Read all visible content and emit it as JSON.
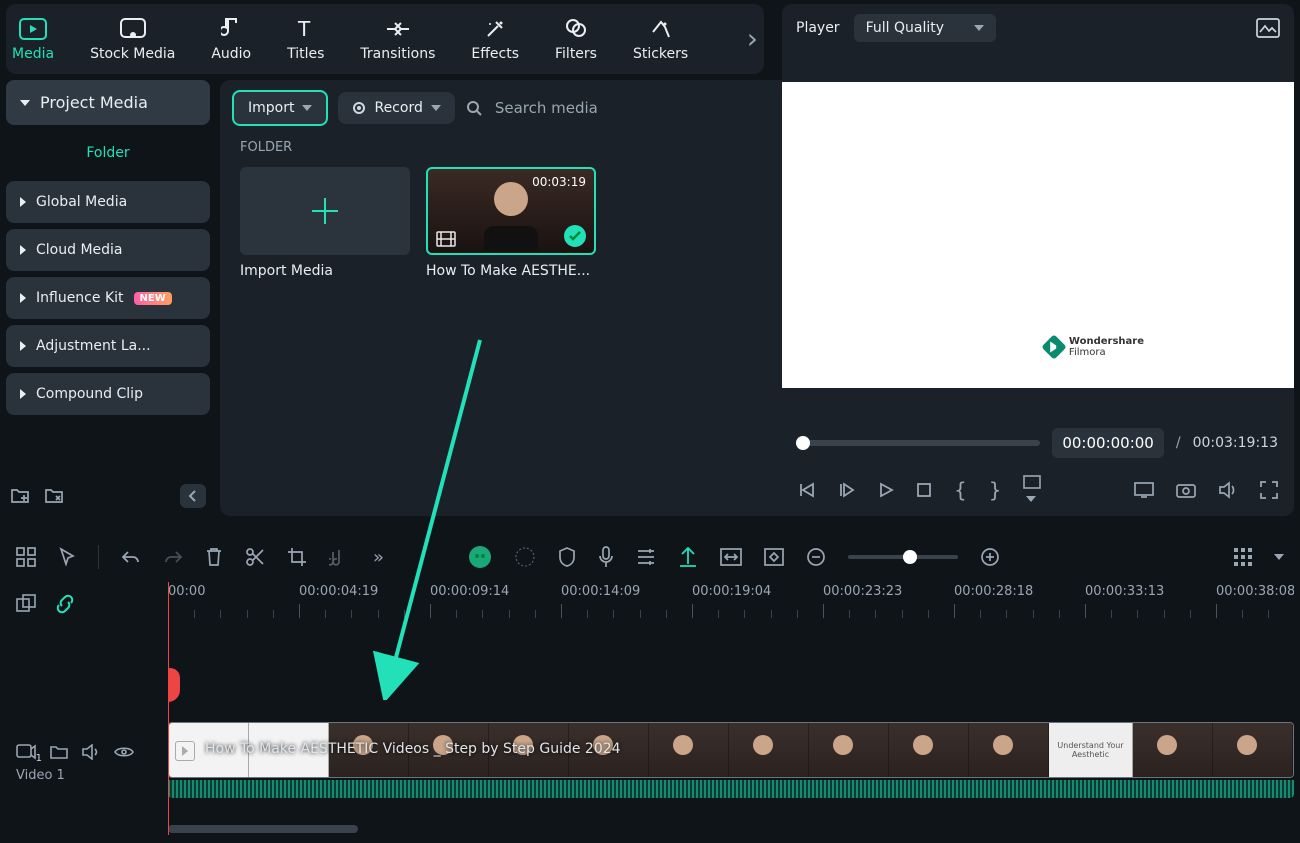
{
  "tabs": {
    "media": "Media",
    "stock": "Stock Media",
    "audio": "Audio",
    "titles": "Titles",
    "transitions": "Transitions",
    "effects": "Effects",
    "filters": "Filters",
    "stickers": "Stickers"
  },
  "sidebar": {
    "project": "Project Media",
    "folder": "Folder",
    "global": "Global Media",
    "cloud": "Cloud Media",
    "influence": "Influence Kit",
    "new_badge": "NEW",
    "adjustment": "Adjustment La...",
    "compound": "Compound Clip"
  },
  "toolbar": {
    "import": "Import",
    "record": "Record",
    "search_placeholder": "Search media"
  },
  "folder_label": "FOLDER",
  "media": {
    "import_media": "Import Media",
    "clip_name": "How To Make AESTHE...",
    "clip_duration": "00:03:19"
  },
  "player": {
    "label": "Player",
    "quality": "Full Quality",
    "watermark_brand": "Wondershare",
    "watermark_product": "Filmora",
    "current": "00:00:00:00",
    "sep": "/",
    "total": "00:03:19:13"
  },
  "ruler": [
    "00:00",
    "00:00:04:19",
    "00:00:09:14",
    "00:00:14:09",
    "00:00:19:04",
    "00:00:23:23",
    "00:00:28:18",
    "00:00:33:13",
    "00:00:38:08"
  ],
  "track": {
    "badge": "1",
    "name": "Video 1",
    "clip_title": "How To Make AESTHETIC Videos _ Step by Step Guide 2024",
    "clip_card": "Understand Your Aesthetic"
  }
}
